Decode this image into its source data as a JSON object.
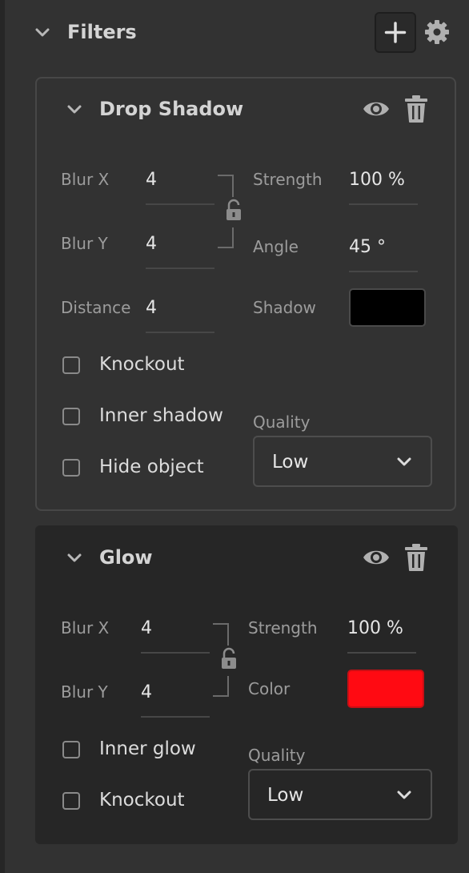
{
  "header": {
    "title": "Filters",
    "icons": [
      "chevron-down-icon",
      "plus-icon",
      "gear-icon"
    ]
  },
  "drop_shadow": {
    "title": "Drop Shadow",
    "blur_x_label": "Blur X",
    "blur_x_value": "4",
    "blur_y_label": "Blur Y",
    "blur_y_value": "4",
    "distance_label": "Distance",
    "distance_value": "4",
    "strength_label": "Strength",
    "strength_value": "100 %",
    "angle_label": "Angle",
    "angle_value": "45 °",
    "shadow_label": "Shadow",
    "shadow_color": "#000000",
    "knockout_label": "Knockout",
    "inner_shadow_label": "Inner shadow",
    "hide_object_label": "Hide object",
    "quality_label": "Quality",
    "quality_value": "Low"
  },
  "glow": {
    "title": "Glow",
    "blur_x_label": "Blur X",
    "blur_x_value": "4",
    "blur_y_label": "Blur Y",
    "blur_y_value": "4",
    "strength_label": "Strength",
    "strength_value": "100 %",
    "color_label": "Color",
    "color_value": "#ff0000",
    "inner_glow_label": "Inner glow",
    "knockout_label": "Knockout",
    "quality_label": "Quality",
    "quality_value": "Low"
  }
}
